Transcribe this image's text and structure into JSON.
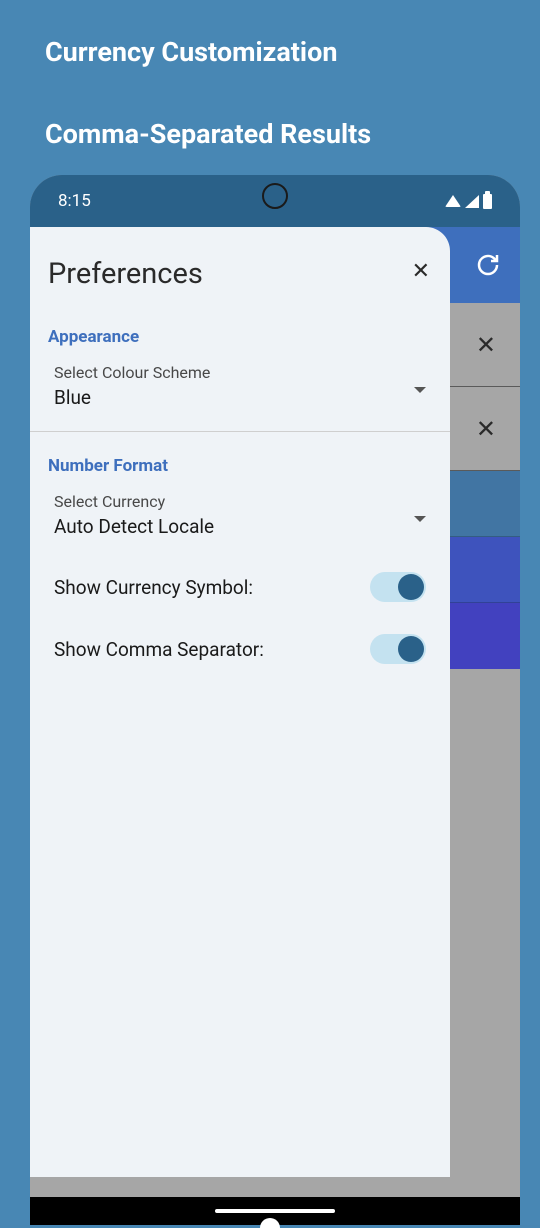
{
  "promo": {
    "heading1": "Currency Customization",
    "heading2": "Comma-Separated Results"
  },
  "status": {
    "time": "8:15"
  },
  "preferences": {
    "title": "Preferences",
    "sections": {
      "appearance": {
        "header": "Appearance",
        "colourScheme": {
          "label": "Select Colour Scheme",
          "value": "Blue"
        }
      },
      "numberFormat": {
        "header": "Number Format",
        "currency": {
          "label": "Select Currency",
          "value": "Auto Detect Locale"
        },
        "showCurrencySymbol": {
          "label": "Show Currency Symbol:",
          "enabled": true
        },
        "showCommaSeparator": {
          "label": "Show Comma Separator:",
          "enabled": true
        }
      }
    }
  }
}
